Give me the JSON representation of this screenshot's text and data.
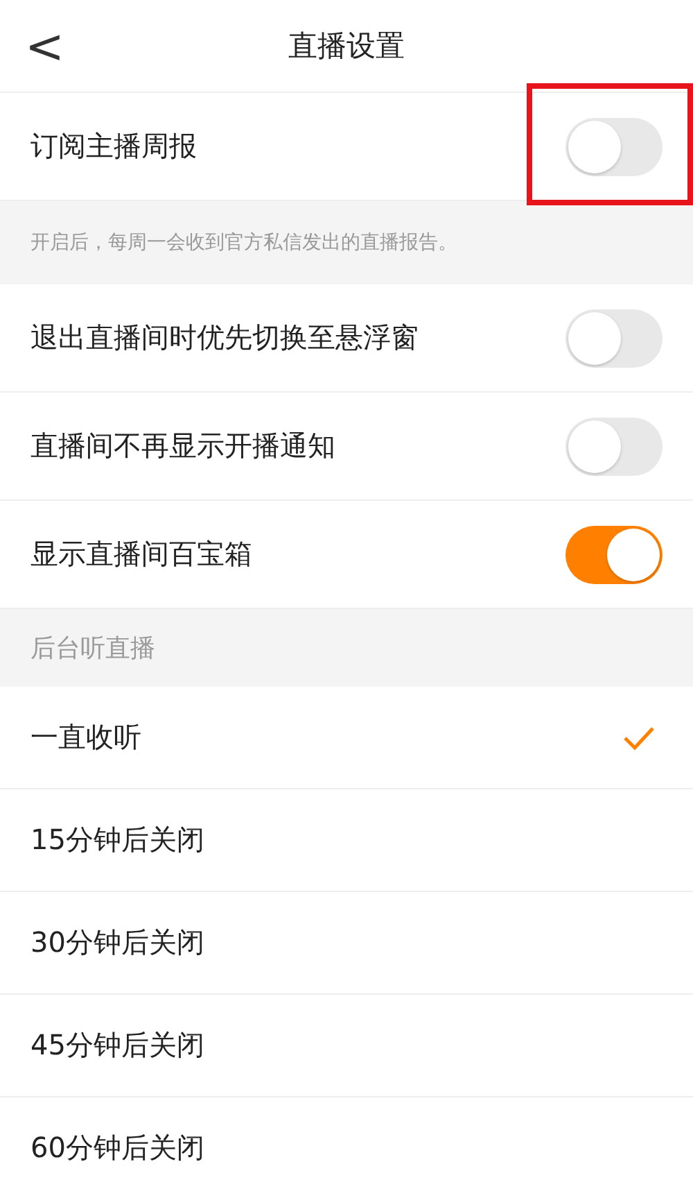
{
  "header": {
    "back": "<",
    "title": "直播设置"
  },
  "settings": [
    {
      "label": "订阅主播周报",
      "on": false,
      "highlighted": true,
      "note": "开启后，每周一会收到官方私信发出的直播报告。"
    },
    {
      "label": "退出直播间时优先切换至悬浮窗",
      "on": false,
      "highlighted": false
    },
    {
      "label": "直播间不再显示开播通知",
      "on": false,
      "highlighted": false
    },
    {
      "label": "显示直播间百宝箱",
      "on": true,
      "highlighted": false
    }
  ],
  "section": {
    "title": "后台听直播",
    "options": [
      {
        "label": "一直收听",
        "selected": true
      },
      {
        "label": "15分钟后关闭",
        "selected": false
      },
      {
        "label": "30分钟后关闭",
        "selected": false
      },
      {
        "label": "45分钟后关闭",
        "selected": false
      },
      {
        "label": "60分钟后关闭",
        "selected": false
      }
    ]
  }
}
